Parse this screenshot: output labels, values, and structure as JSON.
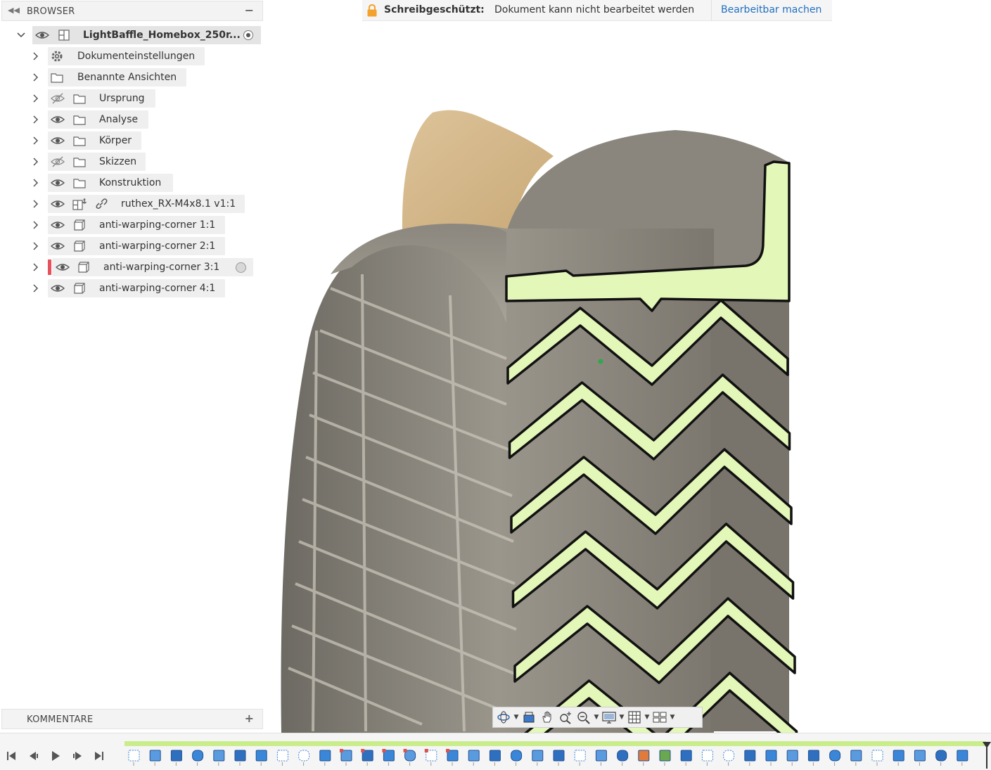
{
  "browser": {
    "title": "BROWSER",
    "root": {
      "label": "LightBaffle_Homebox_250r..."
    },
    "items": [
      {
        "label": "Dokumenteinstellungen",
        "icon": "gear-icon"
      },
      {
        "label": "Benannte Ansichten",
        "icon": "folder-icon"
      },
      {
        "label": "Ursprung",
        "icon": "folder-icon",
        "visible": false
      },
      {
        "label": "Analyse",
        "icon": "folder-icon",
        "visible": true
      },
      {
        "label": "Körper",
        "icon": "folder-icon",
        "visible": true
      },
      {
        "label": "Skizzen",
        "icon": "folder-icon",
        "visible": false
      },
      {
        "label": "Konstruktion",
        "icon": "folder-icon",
        "visible": true
      },
      {
        "label": "ruthex_RX-M4x8.1 v1:1",
        "icon": "linked-component-icon",
        "visible": true
      },
      {
        "label": "anti-warping-corner 1:1",
        "icon": "component-icon",
        "visible": true
      },
      {
        "label": "anti-warping-corner 2:1",
        "icon": "component-icon",
        "visible": true
      },
      {
        "label": "anti-warping-corner 3:1",
        "icon": "component-icon",
        "visible": true,
        "active": true
      },
      {
        "label": "anti-warping-corner 4:1",
        "icon": "component-icon",
        "visible": true
      }
    ]
  },
  "comments": {
    "title": "KOMMENTARE"
  },
  "readonly_banner": {
    "bold_text": "Schreibgeschützt:",
    "message": "Dokument kann nicht bearbeitet werden",
    "action_link": "Bearbeitbar machen"
  },
  "nav_toolbar": {
    "tools": [
      "orbit-icon",
      "look-at-icon",
      "pan-icon",
      "zoom-icon",
      "fit-icon",
      "display-settings-icon",
      "grid-icon",
      "viewports-icon"
    ]
  },
  "timeline": {
    "controls": [
      "skip-to-start-icon",
      "step-back-icon",
      "play-icon",
      "step-forward-icon",
      "skip-to-end-icon"
    ],
    "feature_count": 40
  },
  "colors": {
    "section_fill": "#e2f7b8",
    "part_grey": "#8e8a80",
    "part_tan": "#d8bb8d",
    "timeline_bar": "#c9ed8a",
    "accent_link": "#1f6fbf",
    "active_marker": "#e8505b"
  }
}
